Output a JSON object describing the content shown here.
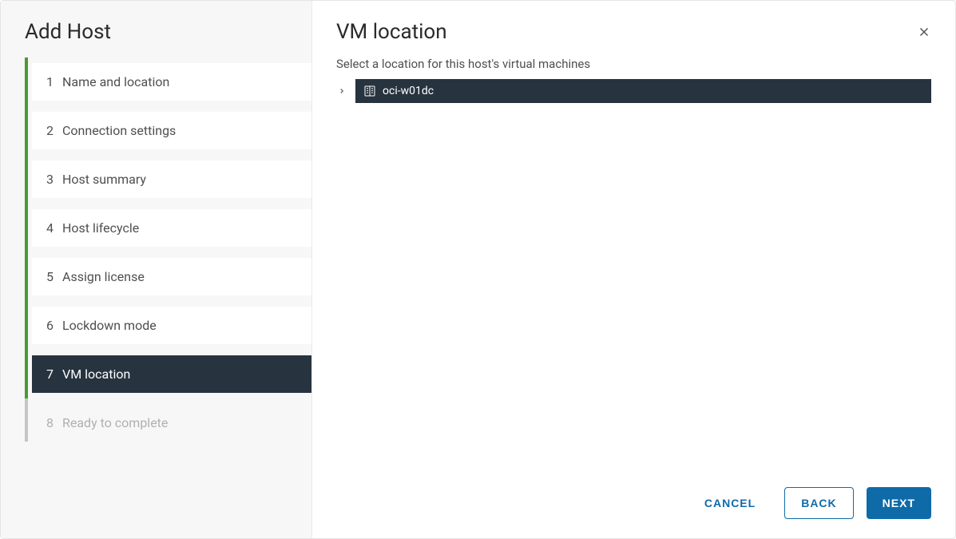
{
  "sidebar": {
    "title": "Add Host",
    "steps": [
      {
        "num": "1",
        "label": "Name and location",
        "state": "completed"
      },
      {
        "num": "2",
        "label": "Connection settings",
        "state": "completed"
      },
      {
        "num": "3",
        "label": "Host summary",
        "state": "completed"
      },
      {
        "num": "4",
        "label": "Host lifecycle",
        "state": "completed"
      },
      {
        "num": "5",
        "label": "Assign license",
        "state": "completed"
      },
      {
        "num": "6",
        "label": "Lockdown mode",
        "state": "completed"
      },
      {
        "num": "7",
        "label": "VM location",
        "state": "active"
      },
      {
        "num": "8",
        "label": "Ready to complete",
        "state": "disabled"
      }
    ]
  },
  "main": {
    "title": "VM location",
    "subtitle": "Select a location for this host's virtual machines",
    "tree": {
      "selected": {
        "label": "oci-w01dc",
        "icon": "datacenter-icon",
        "expandable": true
      }
    }
  },
  "footer": {
    "cancel": "CANCEL",
    "back": "BACK",
    "next": "NEXT"
  }
}
